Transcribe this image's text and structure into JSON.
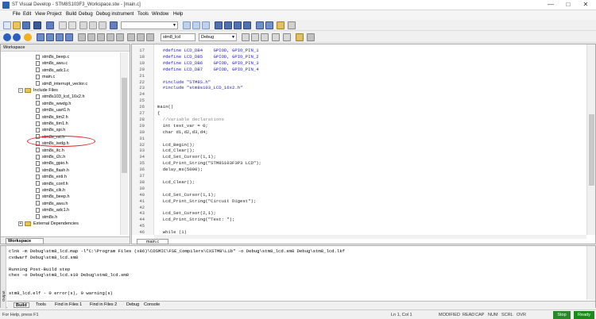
{
  "window": {
    "title": "ST Visual Develop - STM8S103F3_Workspace.stw - [main.c]",
    "buttons": [
      "—",
      "□",
      "✕"
    ]
  },
  "menu": [
    "File",
    "Edit",
    "View",
    "Project",
    "Build",
    "Debug",
    "Debug instrument",
    "Tools",
    "Window",
    "Help"
  ],
  "toolbar2": {
    "project_select": "stm8_lcd",
    "config_select": "Debug"
  },
  "workspace": {
    "title": "Workspace",
    "files_top": [
      "stm8s_beep.c",
      "stm8s_awu.c",
      "stm8s_adc1.c",
      "main.c",
      "stm8_interrupt_vector.c"
    ],
    "include_folder": "Include Files",
    "include_files": [
      "stm8s103_lcd_16x2.h",
      "stm8s_wwdg.h",
      "stm8s_uart1.h",
      "stm8s_tim2.h",
      "stm8s_tim1.h",
      "stm8s_spi.h",
      "stm8s_rst.h",
      "stm8s_iwdg.h",
      "stm8s_itc.h",
      "stm8s_i2c.h",
      "stm8s_gpio.h",
      "stm8s_flash.h",
      "stm8s_exti.h",
      "stm8s_conf.h",
      "stm8s_clk.h",
      "stm8s_beep.h",
      "stm8s_awu.h",
      "stm8s_adc1.h",
      "stm8s.h"
    ],
    "external_folder": "External Dependencies",
    "tab": "Workspace"
  },
  "editor": {
    "tab": "main.c",
    "lines": [
      {
        "n": "17",
        "t": "  #define LCD_DB4    GPIOD, GPIO_PIN_1"
      },
      {
        "n": "18",
        "t": "  #define LCD_DB5    GPIOD, GPIO_PIN_2"
      },
      {
        "n": "19",
        "t": "  #define LCD_DB6    GPIOD, GPIO_PIN_3"
      },
      {
        "n": "20",
        "t": "  #define LCD_DB7    GPIOD, GPIO_PIN_4"
      },
      {
        "n": "21",
        "t": ""
      },
      {
        "n": "22",
        "t": "  #include \"STM8S.h\""
      },
      {
        "n": "23",
        "t": "  #include \"stm8s103_LCD_16x2.h\""
      },
      {
        "n": "24",
        "t": ""
      },
      {
        "n": "25",
        "t": ""
      },
      {
        "n": "26",
        "t": "main()"
      },
      {
        "n": "27",
        "t": "{"
      },
      {
        "n": "28",
        "t": "  //Variable declarations"
      },
      {
        "n": "29",
        "t": "  int test_var = 0;"
      },
      {
        "n": "30",
        "t": "  char d1,d2,d3,d4;"
      },
      {
        "n": "31",
        "t": ""
      },
      {
        "n": "32",
        "t": "  Lcd_Begin();"
      },
      {
        "n": "33",
        "t": "  Lcd_Clear();"
      },
      {
        "n": "34",
        "t": "  Lcd_Set_Cursor(1,1);"
      },
      {
        "n": "35",
        "t": "  Lcd_Print_String(\"STM8S103F3P3 LCD\");"
      },
      {
        "n": "36",
        "t": "  delay_ms(5000);"
      },
      {
        "n": "37",
        "t": ""
      },
      {
        "n": "38",
        "t": "  Lcd_Clear();"
      },
      {
        "n": "39",
        "t": ""
      },
      {
        "n": "40",
        "t": "  Lcd_Set_Cursor(1,1);"
      },
      {
        "n": "41",
        "t": "  Lcd_Print_String(\"Circuit Digest\");"
      },
      {
        "n": "42",
        "t": ""
      },
      {
        "n": "43",
        "t": "  Lcd_Set_Cursor(2,1);"
      },
      {
        "n": "44",
        "t": "  Lcd_Print_String(\"Test: \");"
      },
      {
        "n": "45",
        "t": ""
      },
      {
        "n": "46",
        "t": "  while (1)"
      }
    ]
  },
  "output": {
    "lines": [
      "clnk -m Debug\\stm8_lcd.map -l\"C:\\Program Files (x86)\\COSMIC\\FSE_Compilers\\CXSTM8\\Lib\" -o Debug\\stm8_lcd.sm8 Debug\\stm8_lcd.lkf",
      "cvdwarf Debug\\stm8_lcd.sm8",
      "",
      "Running Post-Build step",
      "chex -o Debug\\stm8_lcd.s19 Debug\\stm8_lcd.sm8",
      "",
      "",
      "stm8_lcd.elf - 0 error(s), 0 warning(s)"
    ],
    "strip_label": "Output",
    "tabs": [
      "Build",
      "Tools",
      "Find in Files 1",
      "Find in Files 2",
      "Debug",
      "Console"
    ]
  },
  "status": {
    "help": "For Help, press F1",
    "ln": "Ln 1, Col 1",
    "modified": "MODIFIED",
    "read": "READ",
    "cap": "CAP",
    "num": "NUM",
    "scrl": "SCRL",
    "ovr": "OVR",
    "stop": "Stop",
    "ready": "Ready"
  },
  "colors": {
    "stop_bg": "#2a8a2a",
    "ready_bg": "#1a8a1a",
    "annotation": "#e02020"
  }
}
